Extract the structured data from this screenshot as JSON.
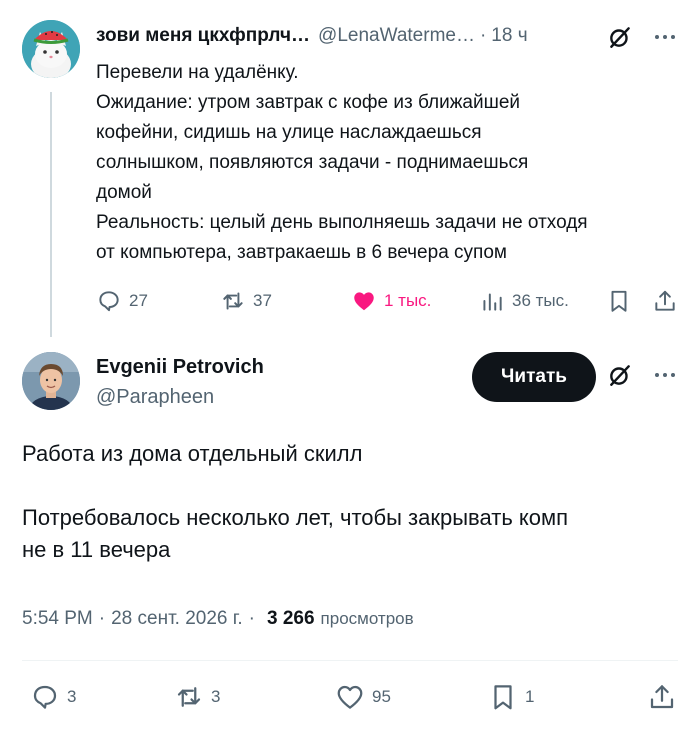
{
  "parent_tweet": {
    "author_name": "зови меня цкхфпрлч…",
    "author_handle": "@LenaWaterme…",
    "separator": "·",
    "time": "18 ч",
    "text_lines": [
      "Перевели на удалёнку.",
      "Ожидание: утром завтрак с кофе из ближайшей",
      "кофейни, сидишь на улице наслаждаешься",
      "солнышком, появляются задачи - поднимаешься",
      "домой",
      "Реальность: целый день выполняешь задачи не отходя",
      "от компьютера, завтракаешь в 6 вечера супом"
    ],
    "actions": {
      "replies": "27",
      "reposts": "37",
      "likes": "1 тыс.",
      "views": "36 тыс."
    },
    "like_color": "#f91880"
  },
  "main_tweet": {
    "author_name": "Evgenii Petrovich",
    "author_handle": "@Parapheen",
    "follow_label": "Читать",
    "text_lines": [
      "Работа из дома отдельный скилл",
      "",
      "Потребовалось несколько лет, чтобы закрывать комп",
      "не в 11 вечера"
    ],
    "time": "5:54 PM",
    "separator": "·",
    "date": "28 сент. 2026 г.",
    "views_count": "3 266",
    "views_label": "просмотров",
    "actions": {
      "replies": "3",
      "reposts": "3",
      "likes": "95",
      "bookmarks": "1"
    }
  },
  "icons": {
    "reply": "reply-icon",
    "repost": "repost-icon",
    "like": "heart-icon",
    "views": "views-icon",
    "bookmark": "bookmark-icon",
    "share": "share-icon",
    "grok": "grok-icon",
    "more": "more-icon"
  },
  "colors": {
    "text": "#0f1419",
    "secondary": "#536471",
    "button_bg": "#0f1419",
    "thread_line": "#cfd9de"
  }
}
